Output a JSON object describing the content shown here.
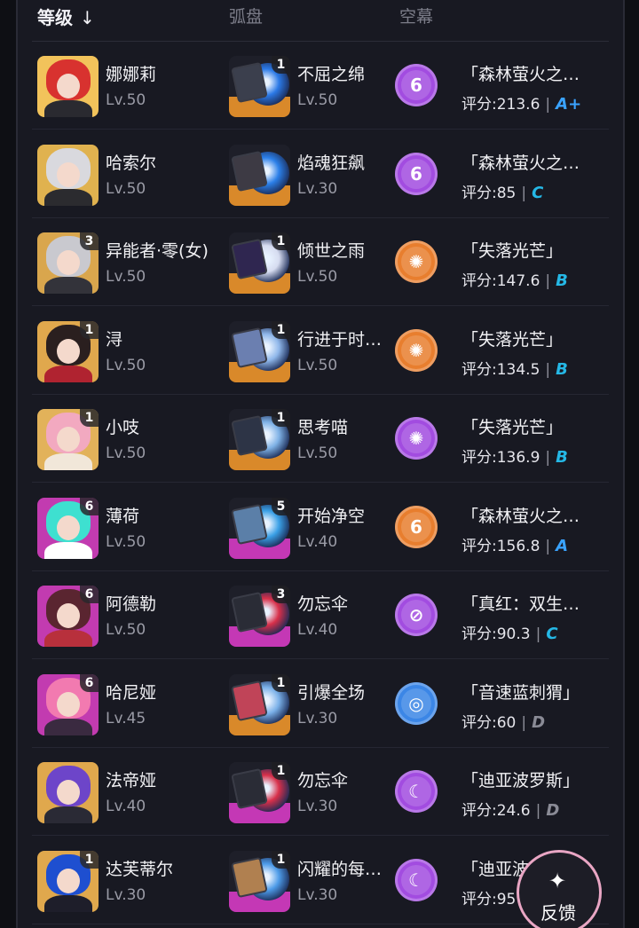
{
  "header": {
    "level_label": "等级",
    "sort_arrow": "↓",
    "disc_label": "弧盘",
    "screen_label": "空幕"
  },
  "rows": [
    {
      "agent": {
        "name": "娜娜莉",
        "level": "Lv.50",
        "rank": "",
        "hair": "#d8322f",
        "outfit": "#2a2a30",
        "bg": "#f2c35b"
      },
      "disc": {
        "name": "不屈之绵",
        "level": "Lv.50",
        "rank": "1",
        "tier_color": "#d9892a",
        "art": "#2b79e6",
        "card": "#3b3f4d"
      },
      "screen": {
        "medal_color": "#a24ce0",
        "icon": "6",
        "icon_name": "swirl-icon",
        "name": "「森林萤火之…",
        "score_label": "评分:213.6",
        "grade": "A+",
        "grade_color": "#3aa3ff"
      }
    },
    {
      "agent": {
        "name": "哈索尔",
        "level": "Lv.50",
        "rank": "",
        "hair": "#d9d9de",
        "outfit": "#2b2b2f",
        "bg": "#e0b24f"
      },
      "disc": {
        "name": "焰魂狂飙",
        "level": "Lv.30",
        "rank": "",
        "tier_color": "#d9892a",
        "art": "#2b7fe8",
        "card": "#3d3a44"
      },
      "screen": {
        "medal_color": "#a24ce0",
        "icon": "6",
        "icon_name": "swirl-icon",
        "name": "「森林萤火之…",
        "score_label": "评分:85",
        "grade": "C",
        "grade_color": "#25b8e6"
      }
    },
    {
      "agent": {
        "name": "异能者·零(女)",
        "level": "Lv.50",
        "rank": "3",
        "hair": "#c9c9cf",
        "outfit": "#33333a",
        "bg": "#d9a64d"
      },
      "disc": {
        "name": "倾世之雨",
        "level": "Lv.50",
        "rank": "1",
        "tier_color": "#d9892a",
        "art": "#d6dcf0",
        "card": "#2f2650"
      },
      "screen": {
        "medal_color": "#e87e2e",
        "icon": "✺",
        "icon_name": "sun-gear-icon",
        "name": "「失落光芒」",
        "score_label": "评分:147.6",
        "grade": "B",
        "grade_color": "#25b8e6"
      }
    },
    {
      "agent": {
        "name": "浔",
        "level": "Lv.50",
        "rank": "1",
        "hair": "#2a1f1f",
        "outfit": "#b02330",
        "bg": "#e0a84d"
      },
      "disc": {
        "name": "行进于时…",
        "level": "Lv.50",
        "rank": "1",
        "tier_color": "#d9892a",
        "art": "#8fb7ea",
        "card": "#6b7fb0"
      },
      "screen": {
        "medal_color": "#e87e2e",
        "icon": "✺",
        "icon_name": "sun-gear-icon",
        "name": "「失落光芒」",
        "score_label": "评分:134.5",
        "grade": "B",
        "grade_color": "#25b8e6"
      }
    },
    {
      "agent": {
        "name": "小吱",
        "level": "Lv.50",
        "rank": "1",
        "hair": "#f2a9c0",
        "outfit": "#f1e7d9",
        "bg": "#e2b25a"
      },
      "disc": {
        "name": "思考喵",
        "level": "Lv.50",
        "rank": "1",
        "tier_color": "#d9892a",
        "art": "#7fb2e6",
        "card": "#2d3446"
      },
      "screen": {
        "medal_color": "#a24ce0",
        "icon": "✺",
        "icon_name": "compass-gear-icon",
        "name": "「失落光芒」",
        "score_label": "评分:136.9",
        "grade": "B",
        "grade_color": "#25b8e6"
      }
    },
    {
      "agent": {
        "name": "薄荷",
        "level": "Lv.50",
        "rank": "6",
        "hair": "#3ee0d0",
        "outfit": "#ffffff",
        "bg": "#c23bb0"
      },
      "disc": {
        "name": "开始净空",
        "level": "Lv.40",
        "rank": "5",
        "tier_color": "#c438b5",
        "art": "#3aa0e6",
        "card": "#5b7fa8"
      },
      "screen": {
        "medal_color": "#e87e2e",
        "icon": "6",
        "icon_name": "swirl-icon",
        "name": "「森林萤火之…",
        "score_label": "评分:156.8",
        "grade": "A",
        "grade_color": "#3aa3ff"
      }
    },
    {
      "agent": {
        "name": "阿德勒",
        "level": "Lv.50",
        "rank": "6",
        "hair": "#5a2530",
        "outfit": "#b8303c",
        "bg": "#c23bb0"
      },
      "disc": {
        "name": "勿忘伞",
        "level": "Lv.40",
        "rank": "3",
        "tier_color": "#c438b5",
        "art": "#d8304a",
        "card": "#2a2c36"
      },
      "screen": {
        "medal_color": "#a24ce0",
        "icon": "⊘",
        "icon_name": "slash-compass-icon",
        "name": "「真红：双生…",
        "score_label": "评分:90.3",
        "grade": "C",
        "grade_color": "#25b8e6"
      }
    },
    {
      "agent": {
        "name": "哈尼娅",
        "level": "Lv.45",
        "rank": "6",
        "hair": "#f27ab0",
        "outfit": "#3a2a40",
        "bg": "#c23bb0"
      },
      "disc": {
        "name": "引爆全场",
        "level": "Lv.30",
        "rank": "1",
        "tier_color": "#d9892a",
        "art": "#7ab0e8",
        "card": "#c04458"
      },
      "screen": {
        "medal_color": "#3b86e6",
        "icon": "◎",
        "icon_name": "ring-target-icon",
        "name": "「音速蓝刺猬」",
        "score_label": "评分:60",
        "grade": "D",
        "grade_color": "#8a8b96"
      }
    },
    {
      "agent": {
        "name": "法帝娅",
        "level": "Lv.40",
        "rank": "",
        "hair": "#6d45c9",
        "outfit": "#2a2a35",
        "bg": "#e0a84d"
      },
      "disc": {
        "name": "勿忘伞",
        "level": "Lv.30",
        "rank": "1",
        "tier_color": "#c438b5",
        "art": "#d8304a",
        "card": "#2a2c36"
      },
      "screen": {
        "medal_color": "#a24ce0",
        "icon": "☾",
        "icon_name": "moon-icon",
        "name": "「迪亚波罗斯」",
        "score_label": "评分:24.6",
        "grade": "D",
        "grade_color": "#8a8b96"
      }
    },
    {
      "agent": {
        "name": "达芙蒂尔",
        "level": "Lv.30",
        "rank": "1",
        "hair": "#1e4fd0",
        "outfit": "#1e1e2a",
        "bg": "#e0a84d"
      },
      "disc": {
        "name": "闪耀的每…",
        "level": "Lv.30",
        "rank": "1",
        "tier_color": "#c438b5",
        "art": "#4d9be8",
        "card": "#b08050"
      },
      "screen": {
        "medal_color": "#a24ce0",
        "icon": "☾",
        "icon_name": "moon-icon",
        "name": "「迪亚波罗",
        "score_label": "评分:95",
        "grade": "",
        "grade_color": "#8a8b96"
      }
    }
  ],
  "feedback": {
    "label": "反馈",
    "icon": "✦"
  }
}
